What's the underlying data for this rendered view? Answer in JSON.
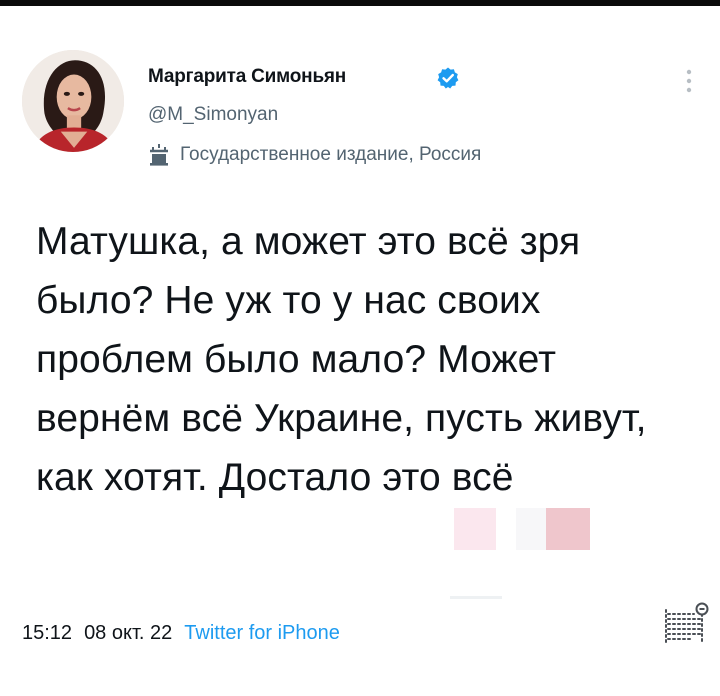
{
  "tweet": {
    "author": {
      "name": "Маргарита Симоньян",
      "handle": "@M_Simonyan",
      "label": "Государственное издание, Россия",
      "verified": true,
      "verified_color": "#1d9bf0"
    },
    "text": "Матушка, а может это всё зря было? Не уж то у нас своих проблем было мало? Может вернём всё Украине, пусть живут, как хотят. Достало это всё",
    "time": "15:12",
    "date": "08 окт. 22",
    "source": "Twitter for iPhone"
  },
  "colors": {
    "text": "#0f1419",
    "secondary": "#536471",
    "accent": "#1d9bf0"
  },
  "icons": [
    "avatar",
    "verified-badge-icon",
    "government-label-icon",
    "more-options-icon",
    "reader-mode-icon"
  ]
}
